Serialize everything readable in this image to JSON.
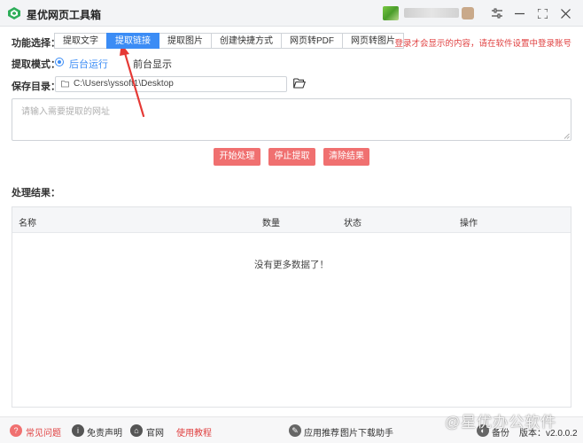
{
  "window": {
    "title": "星优网页工具箱",
    "user_name": "████████"
  },
  "function_select": {
    "label": "功能选择：",
    "tabs": [
      {
        "label": "提取文字",
        "active": false
      },
      {
        "label": "提取链接",
        "active": true
      },
      {
        "label": "提取图片",
        "active": false
      },
      {
        "label": "创建快捷方式",
        "active": false
      },
      {
        "label": "网页转PDF",
        "active": false
      },
      {
        "label": "网页转图片",
        "active": false
      }
    ],
    "login_tip": "登录才会显示的内容，请在软件设置中登录账号"
  },
  "extract_mode": {
    "label": "提取模式：",
    "options": [
      {
        "label": "后台运行",
        "checked": true
      },
      {
        "label": "前台显示",
        "checked": false
      }
    ]
  },
  "save_dir": {
    "label": "保存目录：",
    "value": "C:\\Users\\yssoft1\\Desktop"
  },
  "url_input": {
    "placeholder": "请输入需要提取的网址"
  },
  "actions": {
    "start": "开始处理",
    "stop": "停止提取",
    "clear": "清除结果"
  },
  "results": {
    "label": "处理结果：",
    "columns": [
      "名称",
      "数量",
      "状态",
      "操作"
    ],
    "empty_message": "没有更多数据了！"
  },
  "statusbar": {
    "faq": "常见问题",
    "disclaimer": "免责声明",
    "website": "官网",
    "tutorial": "使用教程",
    "recommend_label": "应用推荐：",
    "recommend_app": "图片下载助手",
    "backup": "备份",
    "version": "版本：v2.0.0.2"
  },
  "watermark": "@星优办公软件",
  "colors": {
    "primary": "#3b8cf5",
    "danger": "#f07070",
    "tip_red": "#e04040",
    "annotation_arrow": "#e53935"
  }
}
